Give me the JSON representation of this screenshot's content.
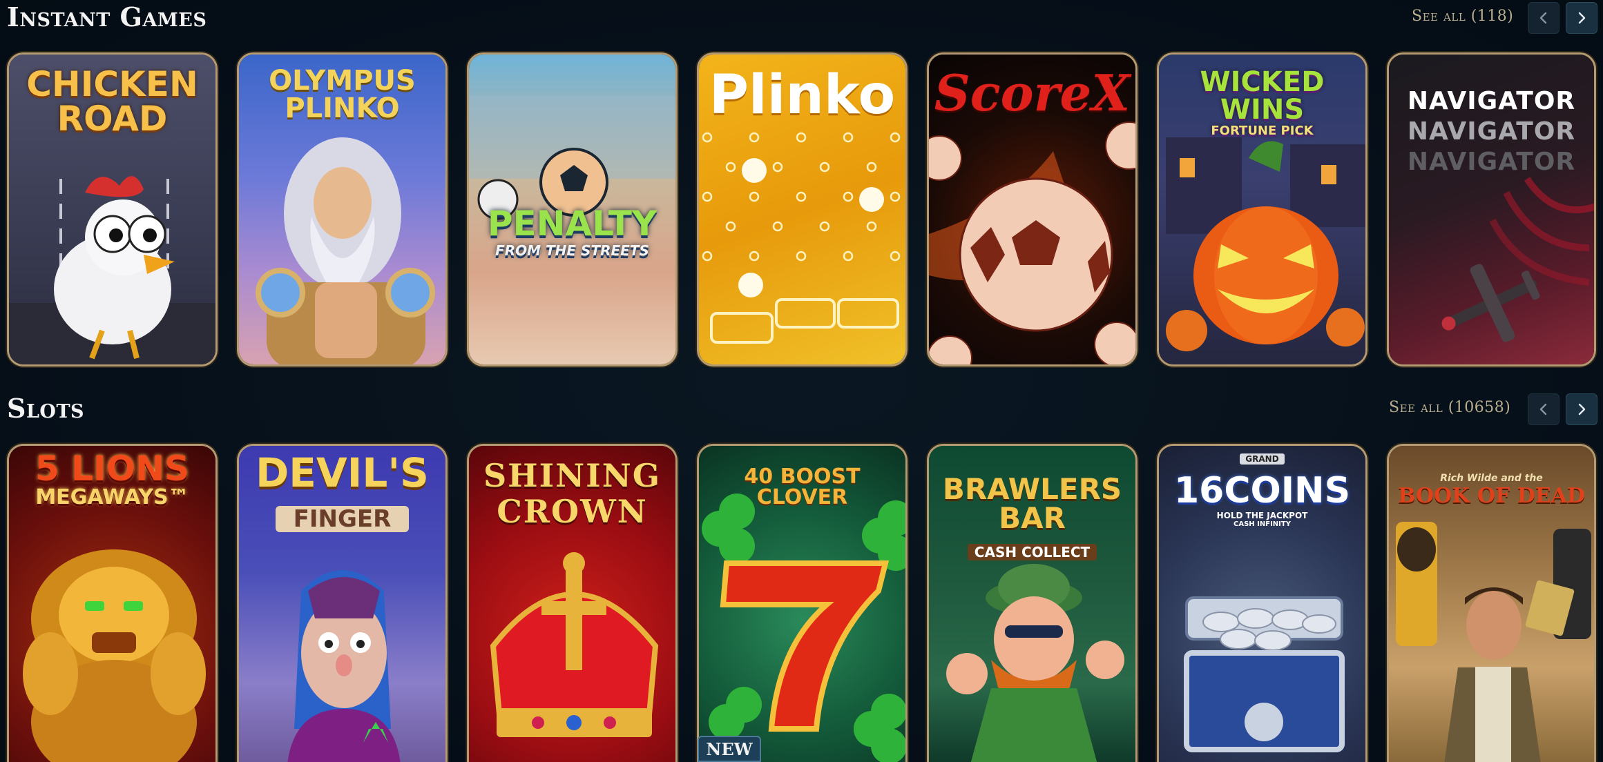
{
  "sections": [
    {
      "title": "Instant Games",
      "see_all": "See all (118)",
      "games": [
        {
          "name": "Chicken Road",
          "logo_lines": [
            "CHICKEN",
            "ROAD"
          ]
        },
        {
          "name": "Olympus Plinko",
          "logo_lines": [
            "OLYMPUS",
            "PLINKO"
          ]
        },
        {
          "name": "Penalty From The Streets",
          "logo_lines": [
            "PENALTY",
            "FROM THE STREETS"
          ]
        },
        {
          "name": "Plinko",
          "logo_lines": [
            "Plinko"
          ]
        },
        {
          "name": "ScoreX",
          "logo_lines": [
            "ScoreX"
          ]
        },
        {
          "name": "Wicked Wins Fortune Pick",
          "logo_lines": [
            "WICKED WINS",
            "FORTUNE PICK"
          ]
        },
        {
          "name": "Navigator",
          "logo_lines": [
            "NAVIGATOR",
            "NAVIGATOR",
            "NAVIGATOR"
          ]
        }
      ]
    },
    {
      "title": "Slots",
      "see_all": "See all (10658)",
      "games": [
        {
          "name": "5 Lions Megaways",
          "logo_lines": [
            "5 LIONS",
            "MEGAWAYS™"
          ]
        },
        {
          "name": "Devil's Finger",
          "logo_lines": [
            "DEVIL'S",
            "FINGER"
          ]
        },
        {
          "name": "Shining Crown",
          "logo_lines": [
            "SHINING",
            "CROWN"
          ]
        },
        {
          "name": "40 Boost Clover",
          "logo_lines": [
            "40 BOOST CLOVER"
          ],
          "badge": "NEW"
        },
        {
          "name": "Brawlers Bar Cash Collect",
          "logo_lines": [
            "BRAWLERS",
            "BAR",
            "CASH COLLECT"
          ]
        },
        {
          "name": "16 Coins",
          "logo_lines": [
            "GRAND",
            "16COINS",
            "HOLD THE JACKPOT",
            "CASH INFINITY"
          ]
        },
        {
          "name": "Book of Dead",
          "logo_lines": [
            "Rich Wilde and the",
            "BOOK OF DEAD"
          ]
        }
      ]
    }
  ],
  "icons": {
    "prev": "chevron-left-icon",
    "next": "chevron-right-icon"
  },
  "colors": {
    "background": "#06111a",
    "card_border": "#b39a72",
    "see_all": "#b9ae8e"
  }
}
